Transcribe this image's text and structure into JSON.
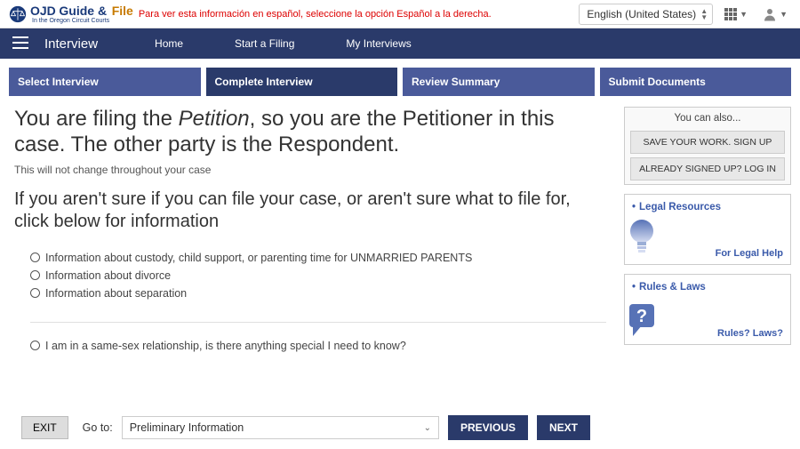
{
  "header": {
    "logo_ojd": "OJD",
    "logo_guide": "Guide &",
    "logo_file": "File",
    "logo_sub": "In the Oregon Circuit Courts",
    "spanish_note": "Para ver esta información en español, seleccione la opción Español a la derecha.",
    "language": "English (United States)"
  },
  "nav": {
    "title": "Interview",
    "links": [
      "Home",
      "Start a Filing",
      "My Interviews"
    ]
  },
  "progress": [
    {
      "label": "Select Interview",
      "active": false
    },
    {
      "label": "Complete Interview",
      "active": true
    },
    {
      "label": "Review Summary",
      "active": false
    },
    {
      "label": "Submit Documents",
      "active": false
    }
  ],
  "content": {
    "heading_pre": "You are filing the ",
    "heading_italic": "Petition",
    "heading_post": ", so you are the Petitioner in this case. The other party is the Respondent.",
    "subnote": "This will not change throughout your case",
    "heading2": "If you aren't sure if you can file your case, or aren't sure what to file for, click below for information",
    "options": [
      "Information about custody, child support, or parenting time for UNMARRIED PARENTS",
      "Information about divorce",
      "Information about separation"
    ],
    "option_extra": "I am in a same-sex relationship, is there anything special I need to know?"
  },
  "sidebar": {
    "also_title": "You can also...",
    "save_btn": "SAVE YOUR WORK. SIGN UP",
    "login_btn": "ALREADY SIGNED UP? LOG IN",
    "legal_title": "Legal Resources",
    "legal_link": "For Legal Help",
    "rules_title": "Rules & Laws",
    "rules_link": "Rules? Laws?"
  },
  "footer": {
    "exit": "EXIT",
    "goto_label": "Go to:",
    "goto_value": "Preliminary Information",
    "previous": "PREVIOUS",
    "next": "NEXT"
  }
}
